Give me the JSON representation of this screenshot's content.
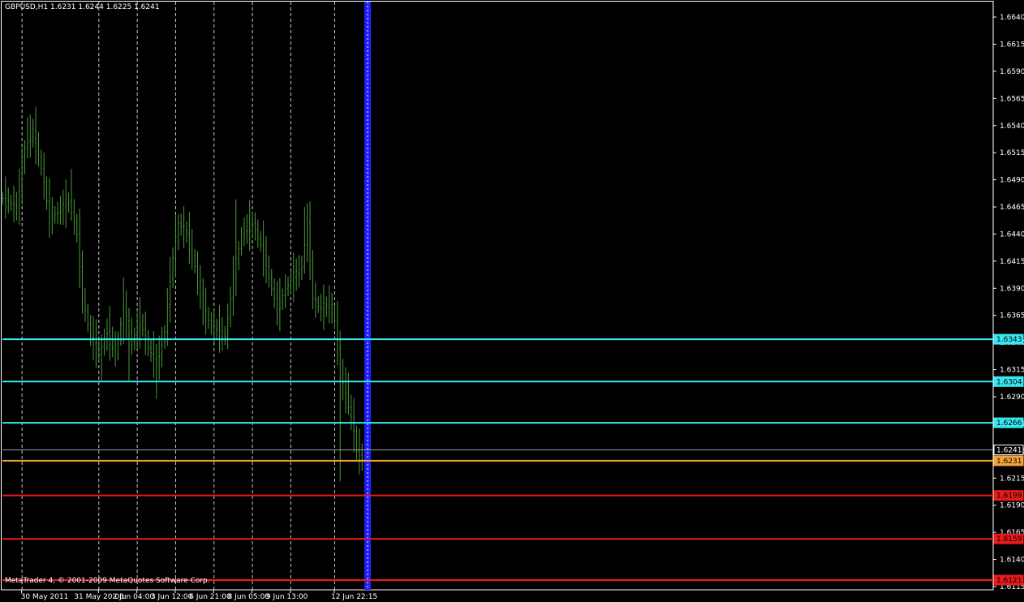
{
  "header": {
    "symbol_line": "GBPUSD,H1  1.6231 1.6244 1.6225 1.6241"
  },
  "footer": {
    "copyright": "MetaTrader 4, © 2001-2009 MetaQuotes Software Corp."
  },
  "colors": {
    "background": "#000000",
    "border": "#ffffff",
    "bars": "#4a9a3a",
    "grid": "#c8c8c8",
    "support_resistance": "#38e8f0",
    "pivot": "#f4a33a",
    "sell_levels": "#e81a1a",
    "bid_line": "#9aa0a8",
    "vertical_marker": "#2020ff",
    "vertical_marker_dots": "#ffffff"
  },
  "chart_data": {
    "type": "bar",
    "symbol": "GBPUSD",
    "timeframe": "H1",
    "ohlc_current": {
      "open": 1.6231,
      "high": 1.6244,
      "low": 1.6225,
      "close": 1.6241
    },
    "ylim": [
      1.6112,
      1.6655
    ],
    "y_ticks": [
      "1.6640",
      "1.6615",
      "1.6590",
      "1.6565",
      "1.6540",
      "1.6515",
      "1.6490",
      "1.6465",
      "1.6440",
      "1.6415",
      "1.6390",
      "1.6365",
      "1.6340",
      "1.6315",
      "1.6290",
      "1.6265",
      "1.6240",
      "1.6215",
      "1.6190",
      "1.6165",
      "1.6140",
      "1.6115"
    ],
    "x_labels": [
      "30 May 2011",
      "31 May 20:00",
      "2 Jun 04:00",
      "3 Jun 12:00",
      "6 Jun 21:00",
      "8 Jun 05:00",
      "9 Jun 13:00",
      "12 Jun 22:15"
    ],
    "grid": "vertical dotted",
    "marker_bar_index": 133,
    "horizontal_levels": [
      {
        "label": "1.6343",
        "value": 1.6343,
        "kind": "resistance"
      },
      {
        "label": "1.6304",
        "value": 1.6304,
        "kind": "resistance"
      },
      {
        "label": "1.6266",
        "value": 1.6266,
        "kind": "resistance"
      },
      {
        "label": "1.6241",
        "value": 1.6241,
        "kind": "bid"
      },
      {
        "label": "1.6231",
        "value": 1.6231,
        "kind": "pivot"
      },
      {
        "label": "1.6199",
        "value": 1.6199,
        "kind": "sell"
      },
      {
        "label": "1.6159",
        "value": 1.6159,
        "kind": "sell"
      },
      {
        "label": "1.6121",
        "value": 1.6121,
        "kind": "sell"
      }
    ],
    "anchors": [
      [
        0,
        1.6473
      ],
      [
        5,
        1.6464
      ],
      [
        8,
        1.652
      ],
      [
        11,
        1.6535
      ],
      [
        14,
        1.65
      ],
      [
        17,
        1.6455
      ],
      [
        20,
        1.646
      ],
      [
        24,
        1.647
      ],
      [
        27,
        1.644
      ],
      [
        29,
        1.638
      ],
      [
        32,
        1.6345
      ],
      [
        35,
        1.633
      ],
      [
        38,
        1.635
      ],
      [
        41,
        1.633
      ],
      [
        44,
        1.637
      ],
      [
        47,
        1.634
      ],
      [
        50,
        1.636
      ],
      [
        53,
        1.6335
      ],
      [
        56,
        1.632
      ],
      [
        59,
        1.635
      ],
      [
        61,
        1.64
      ],
      [
        64,
        1.645
      ],
      [
        67,
        1.644
      ],
      [
        70,
        1.641
      ],
      [
        73,
        1.637
      ],
      [
        76,
        1.6355
      ],
      [
        79,
        1.635
      ],
      [
        81,
        1.6345
      ],
      [
        84,
        1.64
      ],
      [
        87,
        1.644
      ],
      [
        91,
        1.645
      ],
      [
        94,
        1.643
      ],
      [
        97,
        1.64
      ],
      [
        100,
        1.637
      ],
      [
        103,
        1.639
      ],
      [
        106,
        1.64
      ],
      [
        109,
        1.641
      ],
      [
        111,
        1.645
      ],
      [
        113,
        1.638
      ],
      [
        116,
        1.637
      ],
      [
        119,
        1.6375
      ],
      [
        121,
        1.636
      ],
      [
        123,
        1.631
      ],
      [
        125,
        1.629
      ],
      [
        127,
        1.627
      ],
      [
        129,
        1.624
      ],
      [
        131,
        1.6232
      ],
      [
        133,
        1.6236
      ]
    ],
    "spikes": [
      {
        "i": 9,
        "h": 1.6548
      },
      {
        "i": 10,
        "h": 1.655
      },
      {
        "i": 25,
        "h": 1.65
      },
      {
        "i": 44,
        "h": 1.64
      },
      {
        "i": 63,
        "h": 1.6458
      },
      {
        "i": 85,
        "h": 1.6472
      },
      {
        "i": 110,
        "h": 1.6465
      },
      {
        "i": 126,
        "h": 1.6312
      }
    ],
    "dips": [
      {
        "i": 36,
        "l": 1.6305
      },
      {
        "i": 46,
        "l": 1.6305
      },
      {
        "i": 56,
        "l": 1.6288
      },
      {
        "i": 80,
        "l": 1.6332
      },
      {
        "i": 123,
        "l": 1.6212
      }
    ]
  }
}
